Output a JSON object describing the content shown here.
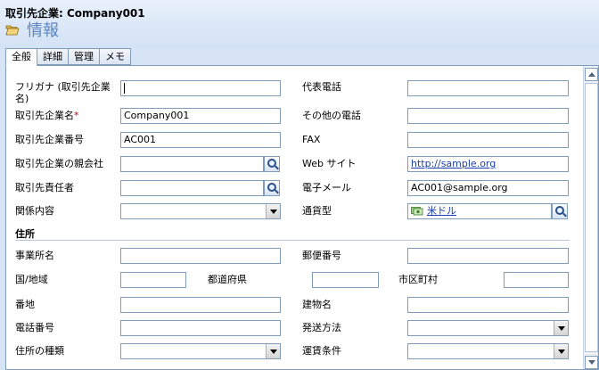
{
  "record_title": "取引先企業: Company001",
  "section_title": "情報",
  "tabs": [
    {
      "label": "全般"
    },
    {
      "label": "詳細"
    },
    {
      "label": "管理"
    },
    {
      "label": "メモ"
    }
  ],
  "left_fields": {
    "furigana_label": "フリガナ (取引先企業名)",
    "furigana_value": "",
    "name_label": "取引先企業名",
    "name_required": "*",
    "name_value": "Company001",
    "number_label": "取引先企業番号",
    "number_value": "AC001",
    "parent_label": "取引先企業の親会社",
    "parent_value": "",
    "owner_label": "取引先責任者",
    "owner_value": "",
    "relation_label": "関係内容",
    "relation_value": ""
  },
  "right_fields": {
    "phone_label": "代表電話",
    "phone_value": "",
    "other_phone_label": "その他の電話",
    "other_phone_value": "",
    "fax_label": "FAX",
    "fax_value": "",
    "web_label": "Web サイト",
    "web_value": "http://sample.org",
    "email_label": "電子メール",
    "email_value": "AC001@sample.org",
    "currency_label": "通貨型",
    "currency_value": "米ドル"
  },
  "address": {
    "group_label": "住所",
    "office_label": "事業所名",
    "office_value": "",
    "postal_label": "郵便番号",
    "postal_value": "",
    "country_label": "国/地域",
    "country_value": "",
    "state_label": "都道府県",
    "state_value": "",
    "city_label": "市区町村",
    "city_value": "",
    "street_label": "番地",
    "street_value": "",
    "building_label": "建物名",
    "building_value": "",
    "phone_label": "電話番号",
    "phone_value": "",
    "shipping_label": "発送方法",
    "shipping_value": "",
    "type_label": "住所の種類",
    "type_value": "",
    "freight_label": "運賃条件",
    "freight_value": ""
  },
  "colors": {
    "accent": "#5a86c4",
    "border": "#7f9db9",
    "link": "#1a3fb0",
    "required": "#cc0000"
  }
}
